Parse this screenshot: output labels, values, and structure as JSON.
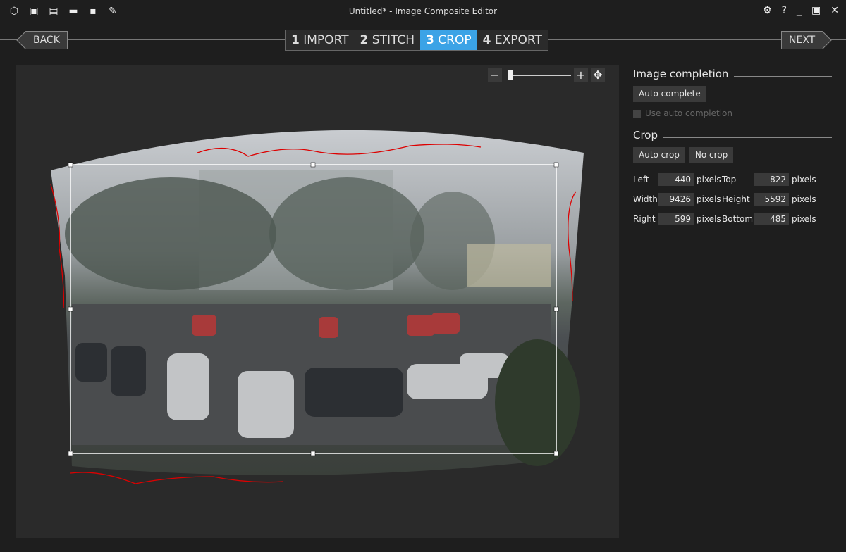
{
  "titlebar": {
    "title": "Untitled* - Image Composite Editor",
    "icons": [
      "new-project-icon",
      "new-panorama-from-images-icon",
      "new-panorama-from-video-icon",
      "open-icon",
      "save-icon",
      "export-icon"
    ],
    "window_icons": [
      "gear-icon",
      "help-icon",
      "minimize-icon",
      "maximize-icon",
      "close-icon"
    ]
  },
  "nav": {
    "back": "BACK",
    "next": "NEXT",
    "steps": [
      {
        "num": "1",
        "label": "IMPORT"
      },
      {
        "num": "2",
        "label": "STITCH"
      },
      {
        "num": "3",
        "label": "CROP",
        "active": true
      },
      {
        "num": "4",
        "label": "EXPORT"
      }
    ],
    "accent": "#3ba3e6"
  },
  "zoom": {
    "minus": "−",
    "plus": "+",
    "level": 0.05
  },
  "panel": {
    "image_completion": {
      "title": "Image completion",
      "auto_complete": "Auto complete",
      "use_auto_completion": "Use auto completion",
      "checked": false
    },
    "crop": {
      "title": "Crop",
      "auto_crop": "Auto crop",
      "no_crop": "No crop",
      "fields": {
        "left": {
          "label": "Left",
          "value": "440"
        },
        "top": {
          "label": "Top",
          "value": "822"
        },
        "width": {
          "label": "Width",
          "value": "9426"
        },
        "height": {
          "label": "Height",
          "value": "5592"
        },
        "right": {
          "label": "Right",
          "value": "599"
        },
        "bottom": {
          "label": "Bottom",
          "value": "485"
        }
      },
      "unit": "pixels"
    }
  }
}
